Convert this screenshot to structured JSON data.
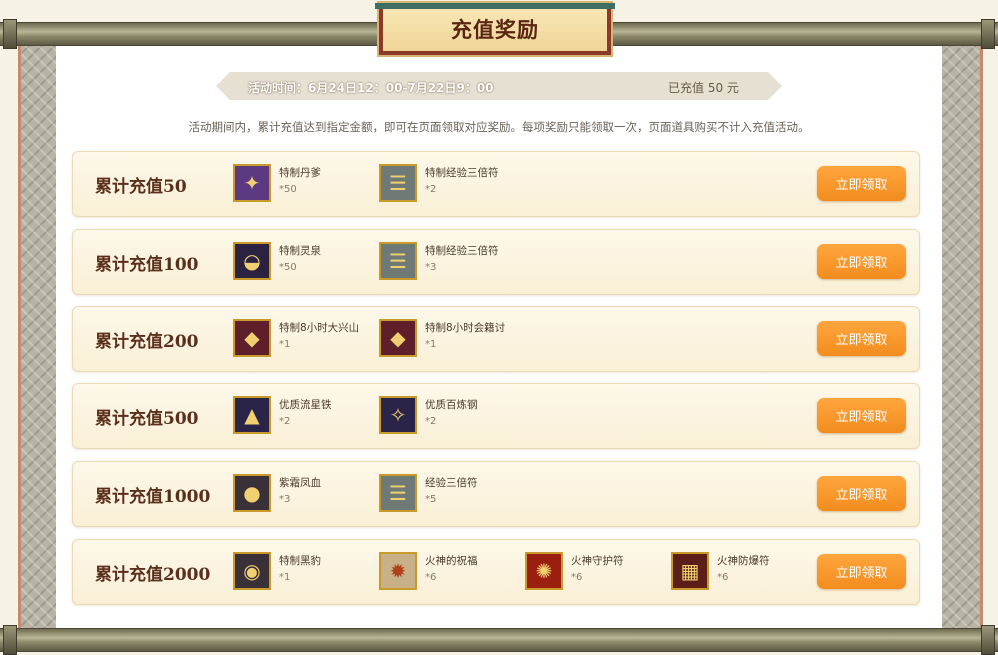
{
  "title": "充值奖励",
  "event": {
    "time_label": "活动时间：6月24日12：00-7月22日9：00",
    "recharged_label": "已充值  50  元"
  },
  "rules_text": "活动期间内，累计充值达到指定金额，即可在页面领取对应奖励。每项奖励只能领取一次，页面道具购买不计入充值活动。",
  "claim_label": "立即领取",
  "tiers": [
    {
      "title": "累计充值50",
      "items": [
        {
          "name": "特制丹爹",
          "qty": "*50",
          "icon": "ginseng-icon"
        },
        {
          "name": "特制经验三倍符",
          "qty": "*2",
          "icon": "scroll-icon"
        }
      ]
    },
    {
      "title": "累计充值100",
      "items": [
        {
          "name": "特制灵泉",
          "qty": "*50",
          "icon": "spring-bowl-icon"
        },
        {
          "name": "特制经验三倍符",
          "qty": "*3",
          "icon": "scroll-icon"
        }
      ]
    },
    {
      "title": "累计充值200",
      "items": [
        {
          "name": "特制8小时大兴山",
          "qty": "*1",
          "icon": "token-icon"
        },
        {
          "name": "特制8小时会籍讨",
          "qty": "*1",
          "icon": "token-icon"
        }
      ]
    },
    {
      "title": "累计充值500",
      "items": [
        {
          "name": "优质流星铁",
          "qty": "*2",
          "icon": "meteor-iron-icon"
        },
        {
          "name": "优质百炼钢",
          "qty": "*2",
          "icon": "steel-icon"
        }
      ]
    },
    {
      "title": "累计充值1000",
      "items": [
        {
          "name": "紫霜凤血",
          "qty": "*3",
          "icon": "phoenix-blood-icon"
        },
        {
          "name": "经验三倍符",
          "qty": "*5",
          "icon": "scroll-icon"
        }
      ]
    },
    {
      "title": "累计充值2000",
      "items": [
        {
          "name": "特制黑豹",
          "qty": "*1",
          "icon": "panther-icon"
        },
        {
          "name": "火神的祝福",
          "qty": "*6",
          "icon": "blessing-icon"
        },
        {
          "name": "火神守护符",
          "qty": "*6",
          "icon": "guard-charm-icon"
        },
        {
          "name": "火神防爆符",
          "qty": "*6",
          "icon": "blast-charm-icon"
        }
      ]
    }
  ]
}
